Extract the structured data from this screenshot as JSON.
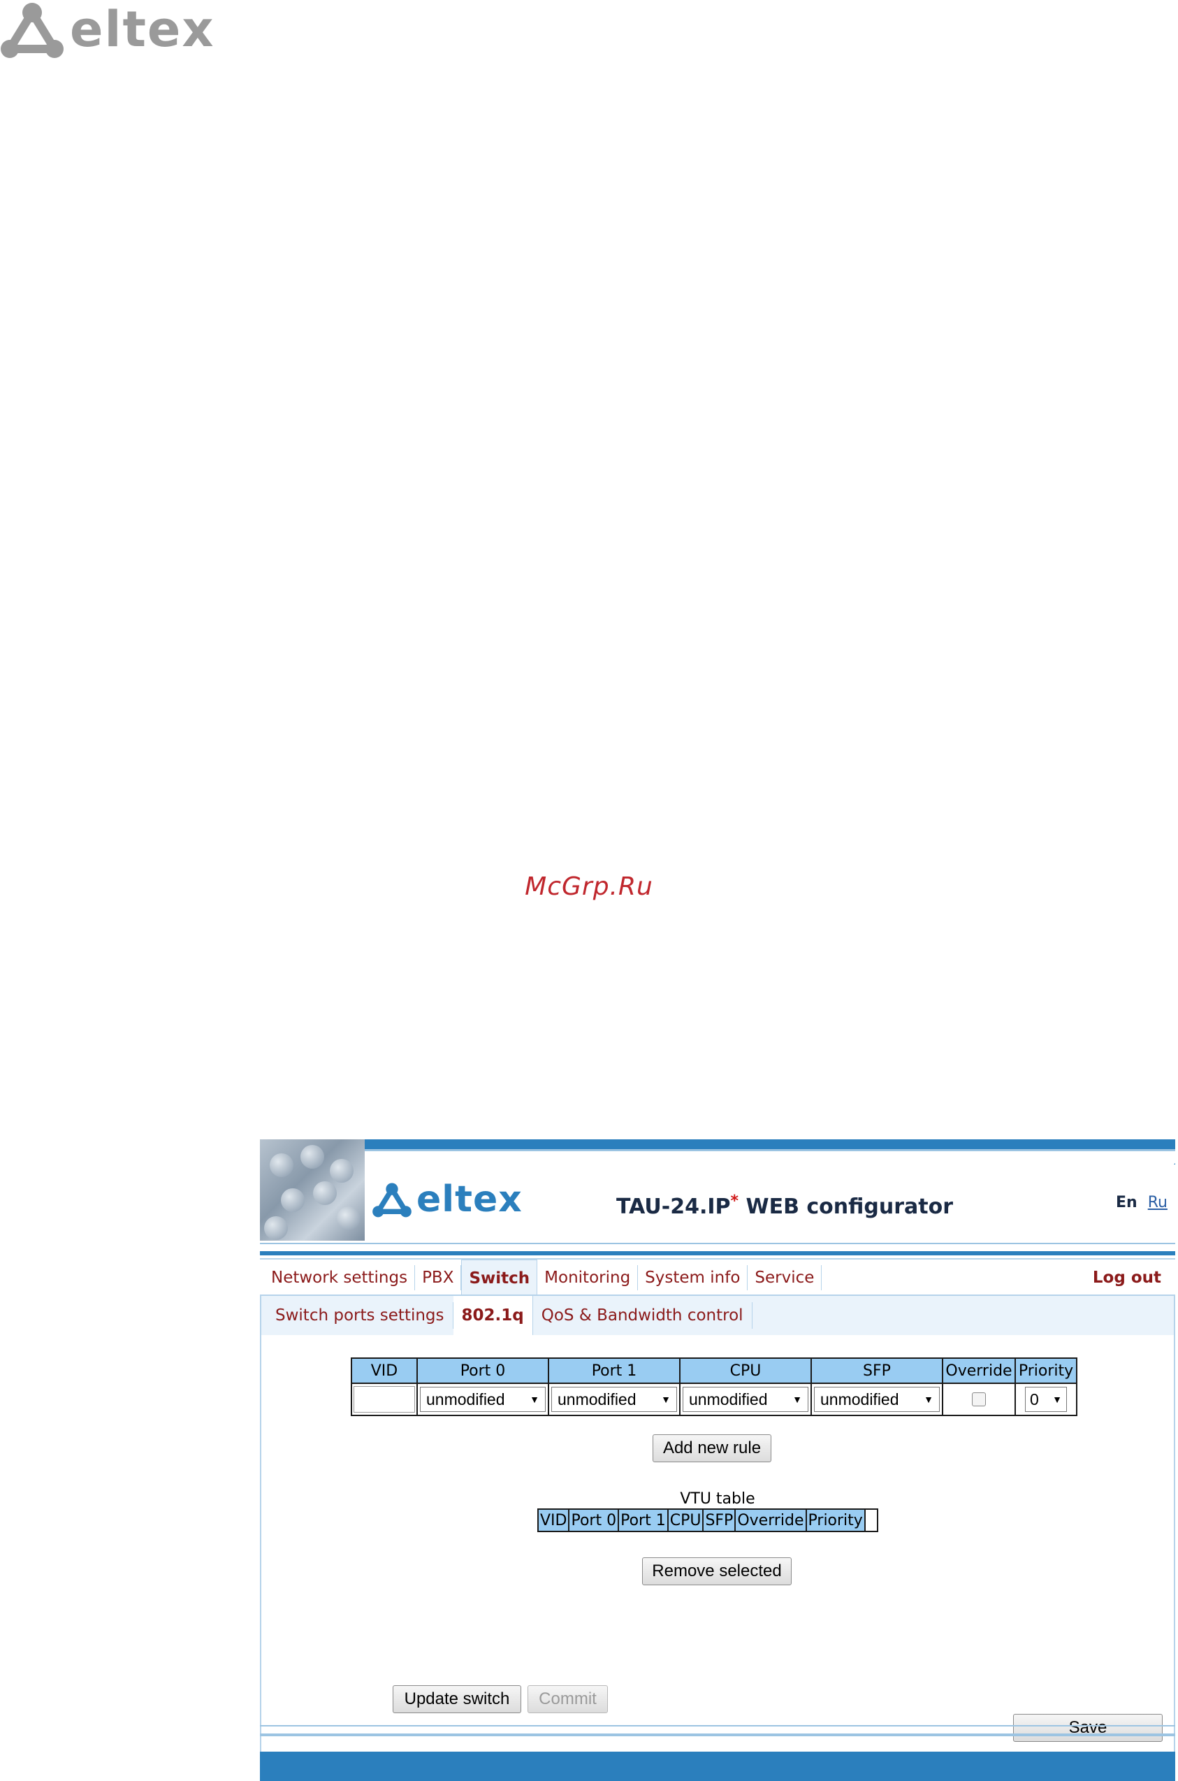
{
  "page_logo": {
    "icon": "eltex-triangle-logo-icon",
    "text": "eltex"
  },
  "watermark": "McGrp.Ru",
  "header": {
    "logo_text": "eltex",
    "title": "TAU-24.IP",
    "title_star": "*",
    "title_suffix": " WEB configurator",
    "lang_en": "En",
    "lang_ru": "Ru"
  },
  "menu": {
    "items": [
      "Network settings",
      "PBX",
      "Switch",
      "Monitoring",
      "System info",
      "Service"
    ],
    "active": "Switch",
    "logout": "Log out"
  },
  "subtabs": {
    "items": [
      "Switch ports settings",
      "802.1q",
      "QoS & Bandwidth control"
    ],
    "active": "802.1q"
  },
  "rule_table": {
    "headers": [
      "VID",
      "Port 0",
      "Port 1",
      "CPU",
      "SFP",
      "Override",
      "Priority"
    ],
    "vid_value": "",
    "port0": "unmodified",
    "port1": "unmodified",
    "cpu": "unmodified",
    "sfp": "unmodified",
    "override_checked": false,
    "priority": "0"
  },
  "buttons": {
    "add_rule": "Add new rule",
    "remove_selected": "Remove selected",
    "update_switch": "Update switch",
    "commit": "Commit",
    "save": "Save"
  },
  "vtu": {
    "caption": "VTU table",
    "headers": [
      "VID",
      "Port 0",
      "Port 1",
      "CPU",
      "SFP",
      "Override",
      "Priority",
      ""
    ]
  }
}
